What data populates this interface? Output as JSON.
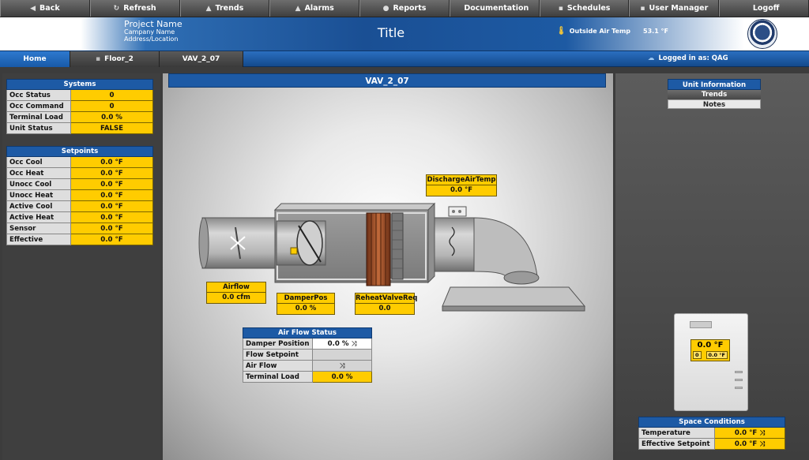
{
  "topnav": [
    {
      "label": "Back",
      "icon": "back-icon",
      "glyph": "◀"
    },
    {
      "label": "Refresh",
      "icon": "refresh-icon",
      "glyph": "↻"
    },
    {
      "label": "Trends",
      "icon": "trends-icon",
      "glyph": "▲"
    },
    {
      "label": "Alarms",
      "icon": "alarms-icon",
      "glyph": "▲"
    },
    {
      "label": "Reports",
      "icon": "reports-icon",
      "glyph": "●"
    },
    {
      "label": "Documentation",
      "icon": "documentation-icon",
      "glyph": ""
    },
    {
      "label": "Schedules",
      "icon": "schedules-icon",
      "glyph": "▪"
    },
    {
      "label": "User Manager",
      "icon": "user-manager-icon",
      "glyph": "▪"
    },
    {
      "label": "Logoff",
      "icon": "logoff-icon",
      "glyph": ""
    }
  ],
  "header": {
    "project_name": "Project Name",
    "company_name": "Campany Name",
    "address": "Address/Location",
    "title": "Title",
    "outside_air_label": "Outside Air Temp",
    "outside_air_value": "53.1 °F",
    "logo_icon": "company-seal-icon"
  },
  "tabs": {
    "home": "Home",
    "floor": "Floor_2",
    "vav": "VAV_2_07",
    "logged_in": "Logged in as: QAG"
  },
  "systems": {
    "title": "Systems",
    "rows": [
      {
        "label": "Occ Status",
        "value": "0"
      },
      {
        "label": "Occ Command",
        "value": "0"
      },
      {
        "label": "Terminal Load",
        "value": "0.0 %"
      },
      {
        "label": "Unit Status",
        "value": "FALSE"
      }
    ]
  },
  "setpoints": {
    "title": "Setpoints",
    "rows": [
      {
        "label": "Occ Cool",
        "value": "0.0 °F"
      },
      {
        "label": "Occ Heat",
        "value": "0.0 °F"
      },
      {
        "label": "Unocc Cool",
        "value": "0.0 °F"
      },
      {
        "label": "Unocc Heat",
        "value": "0.0 °F"
      },
      {
        "label": "Active Cool",
        "value": "0.0 °F"
      },
      {
        "label": "Active Heat",
        "value": "0.0 °F"
      },
      {
        "label": "Sensor",
        "value": "0.0 °F"
      },
      {
        "label": "Effective",
        "value": "0.0 °F"
      }
    ]
  },
  "graphic": {
    "title": "VAV_2_07",
    "discharge_air_temp": {
      "label": "DischargeAirTemp",
      "value": "0.0 °F"
    },
    "airflow": {
      "label": "Airflow",
      "value": "0.0 cfm"
    },
    "damper_pos": {
      "label": "DamperPos",
      "value": "0.0 %"
    },
    "reheat_valve": {
      "label": "ReheatValveReq",
      "value": "0.0"
    }
  },
  "airflow_status": {
    "title": "Air Flow Status",
    "damper_position": {
      "label": "Damper Position",
      "value": "0.0 %"
    },
    "flow_setpoint": {
      "label": "Flow Setpoint",
      "value": ""
    },
    "air_flow": {
      "label": "Air Flow",
      "value": ""
    },
    "terminal_load": {
      "label": "Terminal Load",
      "value": "0.0 %"
    },
    "override_icon": "override-icon"
  },
  "unit_info": {
    "title": "Unit Information",
    "trends": "Trends",
    "notes": "Notes"
  },
  "thermostat": {
    "display": "0.0 °F",
    "left_small": "0",
    "right_small": "0.0 °F"
  },
  "space_conditions": {
    "title": "Space Conditions",
    "temperature": {
      "label": "Temperature",
      "value": "0.0 °F"
    },
    "effective_setpoint": {
      "label": "Effective Setpoint",
      "value": "0.0 °F"
    }
  },
  "colors": {
    "accent_blue": "#1d5aa5",
    "value_yellow": "#ffcc00",
    "nav_gray": "#4a4a4a"
  }
}
